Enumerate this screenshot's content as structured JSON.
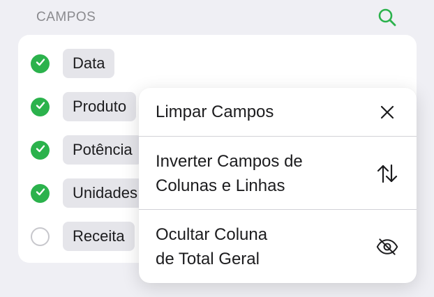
{
  "header": {
    "title": "CAMPOS",
    "search_icon": "search-icon",
    "accent_color": "#2bb24c"
  },
  "fields": [
    {
      "label": "Data",
      "checked": true
    },
    {
      "label": "Produto",
      "checked": true
    },
    {
      "label": "Potência",
      "checked": true
    },
    {
      "label": "Unidades",
      "checked": true
    },
    {
      "label": "Receita",
      "checked": false
    }
  ],
  "menu": {
    "items": [
      {
        "label": "Limpar Campos",
        "icon": "close-icon"
      },
      {
        "label": "Inverter Campos de\nColunas e Linhas",
        "icon": "swap-arrows-icon"
      },
      {
        "label": "Ocultar Coluna\nde Total Geral",
        "icon": "eye-slash-icon"
      }
    ]
  }
}
